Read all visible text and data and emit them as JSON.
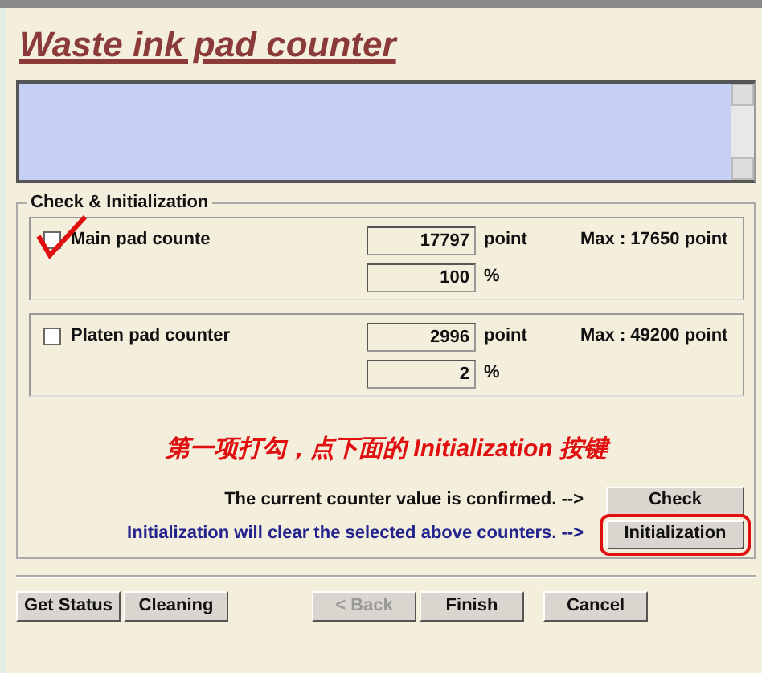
{
  "title": "Waste ink pad counter",
  "group": {
    "legend": "Check & Initialization",
    "counters": [
      {
        "label": "Main pad counte",
        "checked": false,
        "annotated": true,
        "value": "17797",
        "unit": "point",
        "max": "Max : 17650 point",
        "percent": "100",
        "percent_unit": "%"
      },
      {
        "label": "Platen pad counter",
        "checked": false,
        "annotated": false,
        "value": "2996",
        "unit": "point",
        "max": "Max : 49200 point",
        "percent": "2",
        "percent_unit": "%"
      }
    ]
  },
  "annotation": "第一项打勾，点下面的 Initialization 按键",
  "actions": [
    {
      "text": "The current counter value is confirmed. -->",
      "kind": "plain",
      "button": "Check",
      "circled": false
    },
    {
      "text": "Initialization will clear the selected above counters. -->",
      "kind": "blue",
      "button": "Initialization",
      "circled": true
    }
  ],
  "footer_left_buttons": [
    {
      "label": "Get Status",
      "disabled": false
    },
    {
      "label": "Cleaning",
      "disabled": false
    }
  ],
  "footer_right_buttons": [
    {
      "label": "< Back",
      "disabled": true
    },
    {
      "label": "Finish",
      "disabled": false
    },
    {
      "label": "Cancel",
      "disabled": false
    }
  ]
}
